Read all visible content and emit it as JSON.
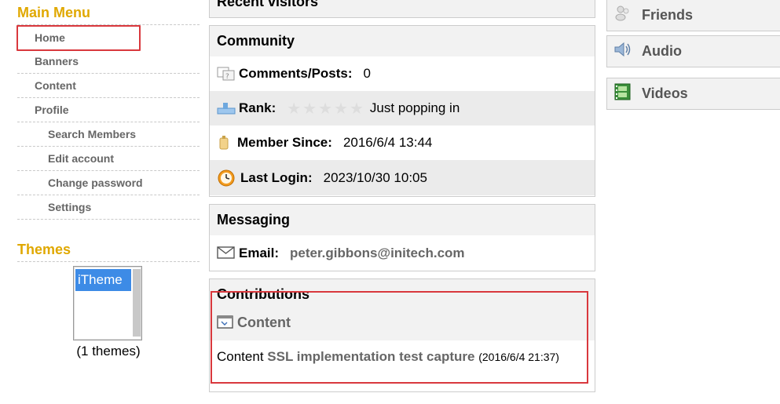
{
  "left": {
    "main_menu_title": "Main Menu",
    "menu": [
      {
        "label": "Home",
        "level": 1
      },
      {
        "label": "Banners",
        "level": 1
      },
      {
        "label": "Content",
        "level": 1
      },
      {
        "label": "Profile",
        "level": 1
      },
      {
        "label": "Search Members",
        "level": 2
      },
      {
        "label": "Edit account",
        "level": 2
      },
      {
        "label": "Change password",
        "level": 2
      },
      {
        "label": "Settings",
        "level": 2
      }
    ],
    "themes_title": "Themes",
    "theme_selected": "iTheme",
    "theme_count": "(1 themes)"
  },
  "recent": {
    "title": "Recent visitors"
  },
  "community": {
    "title": "Community",
    "comments_label": "Comments/Posts:",
    "comments_value": "0",
    "rank_label": "Rank:",
    "rank_text": "Just popping in",
    "rank_stars": 0,
    "member_label": "Member Since:",
    "member_value": "2016/6/4 13:44",
    "login_label": "Last Login:",
    "login_value": "2023/10/30 10:05"
  },
  "messaging": {
    "title": "Messaging",
    "email_label": "Email:",
    "email_value": "peter.gibbons@initech.com"
  },
  "contributions": {
    "title": "Contributions",
    "section_label": "Content",
    "entry_prefix": "Content",
    "entry_link": "SSL implementation test capture",
    "entry_date": "(2016/6/4 21:37)"
  },
  "right": {
    "friends": "Friends",
    "audio": "Audio",
    "videos": "Videos"
  }
}
